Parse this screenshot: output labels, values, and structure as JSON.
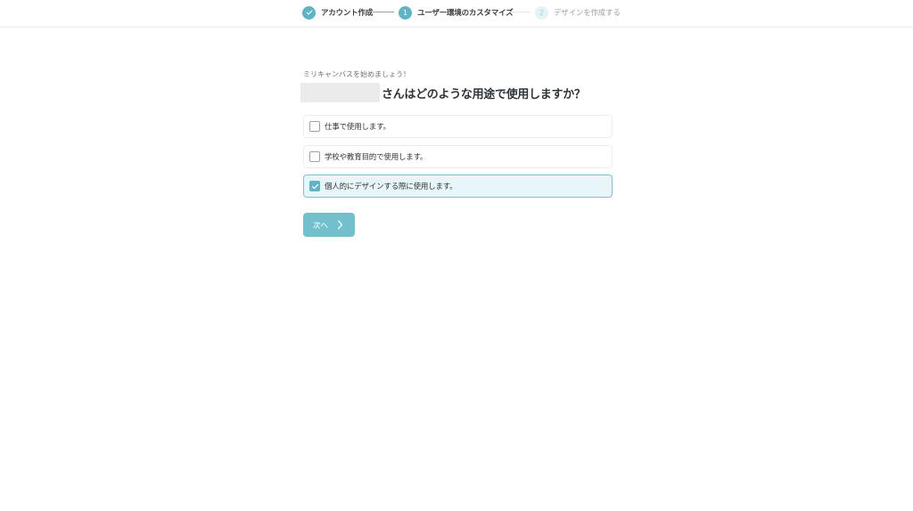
{
  "stepper": {
    "steps": [
      {
        "label": "アカウント作成",
        "marker": "✓",
        "state": "done"
      },
      {
        "label": "ユーザー環境のカスタマイズ",
        "marker": "1",
        "state": "active"
      },
      {
        "label": "デザインを作成する",
        "marker": "2",
        "state": "pending"
      }
    ]
  },
  "main": {
    "eyebrow": "ミリキャンバスを始めましょう！",
    "title": "さんはどのような用途で使用しますか？",
    "options": [
      {
        "label": "仕事で使用します。",
        "checked": false
      },
      {
        "label": "学校や教育目的で使用します。",
        "checked": false
      },
      {
        "label": "個人的にデザインする際に使用します。",
        "checked": true
      }
    ],
    "next_label": "次へ"
  },
  "colors": {
    "accent": "#5db4c4",
    "button": "#72c0cc",
    "selected_bg": "#e9f6f9"
  },
  "icons": {
    "step_done": "check-icon",
    "checkbox_checked": "check-icon",
    "next": "chevron-right-icon"
  }
}
